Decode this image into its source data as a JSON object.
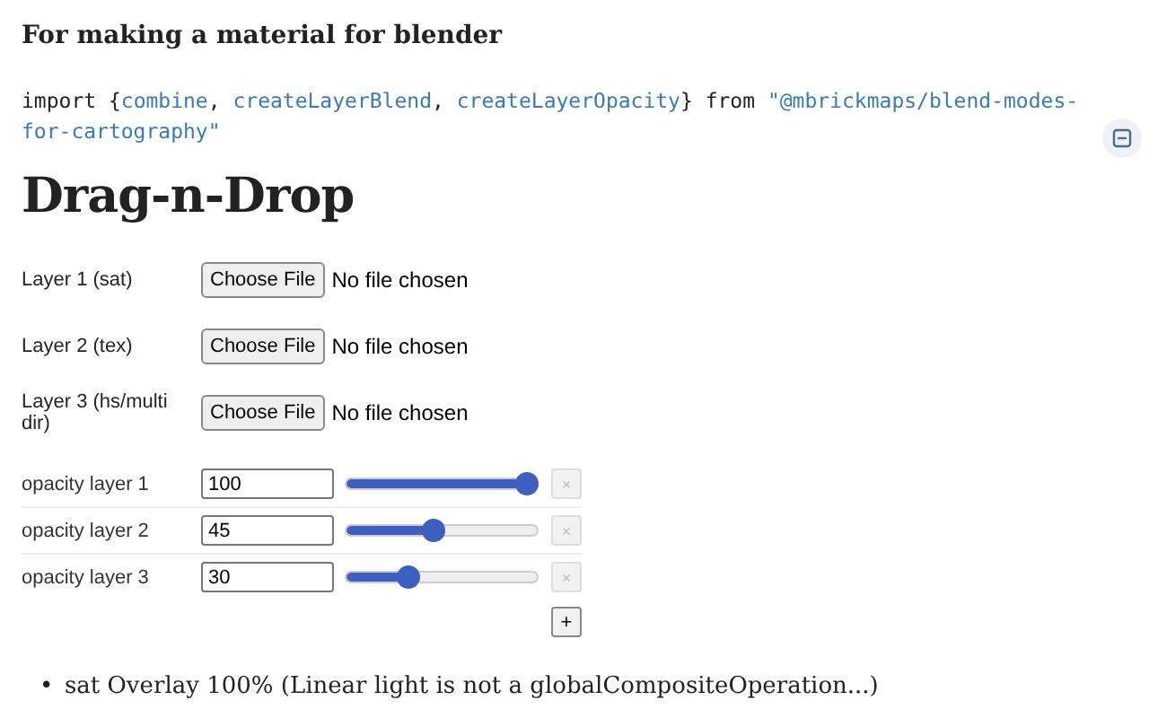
{
  "subtitle": "For making a material for blender",
  "code": [
    {
      "kind": "plain",
      "text": "import {"
    },
    {
      "kind": "name",
      "text": "combine"
    },
    {
      "kind": "plain",
      "text": ", "
    },
    {
      "kind": "name",
      "text": "createLayerBlend"
    },
    {
      "kind": "plain",
      "text": ", "
    },
    {
      "kind": "name",
      "text": "createLayerOpacity"
    },
    {
      "kind": "plain",
      "text": "} from "
    },
    {
      "kind": "string",
      "text": "\"@mbrickmaps/blend-modes-for-cartography\""
    }
  ],
  "heading": "Drag-n-Drop",
  "file_inputs": [
    {
      "label": "Layer 1 (sat)",
      "button": "Choose File",
      "status": "No file chosen"
    },
    {
      "label": "Layer 2 (tex)",
      "button": "Choose File",
      "status": "No file chosen"
    },
    {
      "label": "Layer 3 (hs/multi dir)",
      "button": "Choose File",
      "status": "No file chosen"
    }
  ],
  "opacity_layers": [
    {
      "label": "opacity layer 1",
      "value": "100",
      "level": 1.0,
      "remove": "×",
      "disabled": true
    },
    {
      "label": "opacity layer 2",
      "value": "45",
      "level": 0.45,
      "remove": "×",
      "disabled": true
    },
    {
      "label": "opacity layer 3",
      "value": "30",
      "level": 0.3,
      "remove": "×",
      "disabled": true
    }
  ],
  "add_button": "+",
  "notes": [
    {
      "bullet": "•",
      "text": "sat Overlay 100% (Linear light is not a globalCompositeOperation...)"
    }
  ]
}
